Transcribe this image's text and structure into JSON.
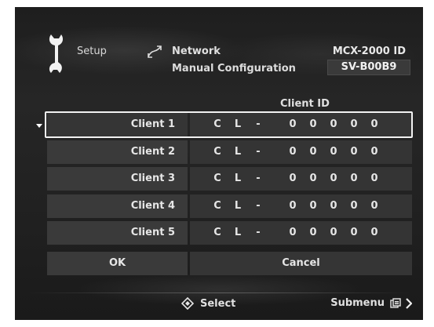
{
  "header": {
    "setup_label": "Setup",
    "network_label": "Network",
    "subtitle": "Manual Configuration",
    "model_id": "MCX-2000 ID",
    "serial": "SV-B00B9"
  },
  "table": {
    "column_header": "Client ID",
    "rows": [
      {
        "name": "Client 1",
        "id_chars": [
          "C",
          "L",
          "-",
          "0",
          "0",
          "0",
          "0",
          "0"
        ],
        "selected": true
      },
      {
        "name": "Client 2",
        "id_chars": [
          "C",
          "L",
          "-",
          "0",
          "0",
          "0",
          "0",
          "0"
        ],
        "selected": false
      },
      {
        "name": "Client 3",
        "id_chars": [
          "C",
          "L",
          "-",
          "0",
          "0",
          "0",
          "0",
          "0"
        ],
        "selected": false
      },
      {
        "name": "Client 4",
        "id_chars": [
          "C",
          "L",
          "-",
          "0",
          "0",
          "0",
          "0",
          "0"
        ],
        "selected": false
      },
      {
        "name": "Client 5",
        "id_chars": [
          "C",
          "L",
          "-",
          "0",
          "0",
          "0",
          "0",
          "0"
        ],
        "selected": false
      }
    ]
  },
  "actions": {
    "ok_label": "OK",
    "cancel_label": "Cancel"
  },
  "footer": {
    "select_label": "Select",
    "submenu_label": "Submenu"
  },
  "icons": {
    "setup": "wrench-icon",
    "network": "network-icon",
    "select": "nav-diamond-icon",
    "submenu": "submenu-icon",
    "next": "chevron-right-icon"
  },
  "colors": {
    "background": "#222222",
    "cell": "#3a3a3a",
    "text": "#e6e6e6",
    "selection_border": "#f2f2f2"
  }
}
